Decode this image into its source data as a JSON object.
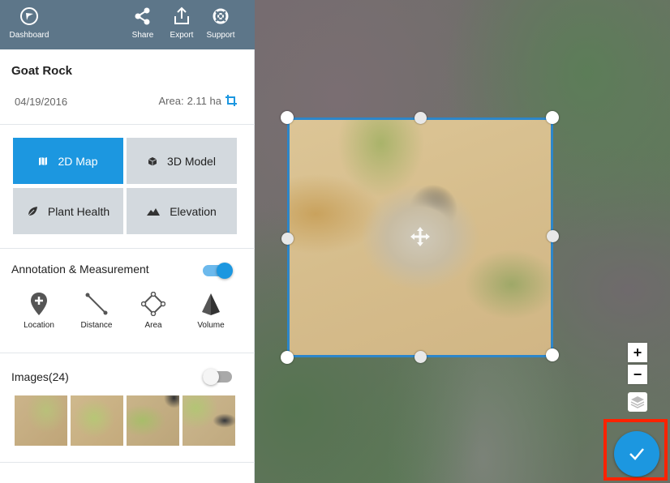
{
  "topbar": {
    "dashboard_label": "Dashboard",
    "share_label": "Share",
    "export_label": "Export",
    "support_label": "Support",
    "bg_color": "#5d7689"
  },
  "project": {
    "title": "Goat Rock",
    "date": "04/19/2016",
    "area_label": "Area:",
    "area_value": "2.11 ha"
  },
  "views": [
    {
      "label": "2D Map",
      "icon": "map-icon",
      "active": true
    },
    {
      "label": "3D Model",
      "icon": "cube-icon",
      "active": false
    },
    {
      "label": "Plant Health",
      "icon": "leaf-icon",
      "active": false
    },
    {
      "label": "Elevation",
      "icon": "mountain-icon",
      "active": false
    }
  ],
  "annotation": {
    "title": "Annotation & Measurement",
    "enabled": true,
    "tools": [
      {
        "label": "Location",
        "icon": "location-pin-icon"
      },
      {
        "label": "Distance",
        "icon": "ruler-line-icon"
      },
      {
        "label": "Area",
        "icon": "polygon-area-icon"
      },
      {
        "label": "Volume",
        "icon": "volume-pyramid-icon"
      }
    ]
  },
  "images": {
    "title": "Images(24)",
    "enabled": false
  },
  "map": {
    "zoom_in_label": "+",
    "zoom_out_label": "−"
  },
  "colors": {
    "accent": "#1c97e0",
    "crop_border": "#2d86c9",
    "highlight": "#ff2200"
  }
}
